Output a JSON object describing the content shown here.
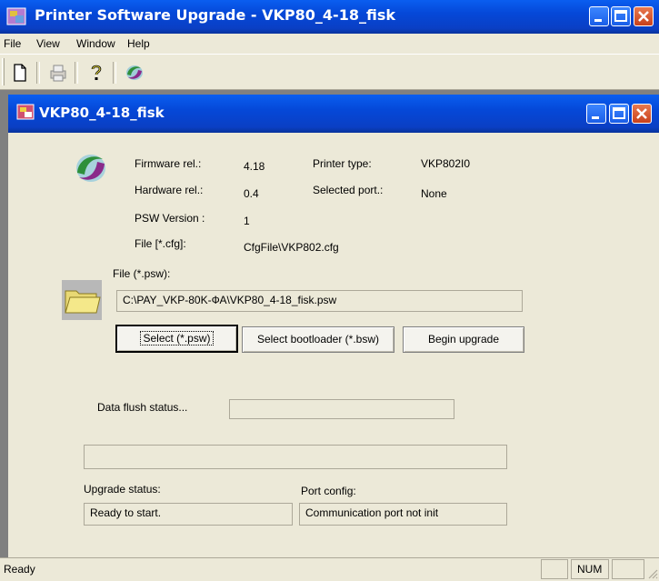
{
  "outer_window": {
    "title": "Printer Software Upgrade - VKP80_4-18_fisk"
  },
  "menu": {
    "items": [
      "File",
      "View",
      "Window",
      "Help"
    ]
  },
  "toolbar": {
    "icons": [
      "new-document-icon",
      "print-icon",
      "help-icon",
      "logo-icon"
    ]
  },
  "child_window": {
    "title": "VKP80_4-18_fisk"
  },
  "info": {
    "firmware_label": "Firmware rel.:",
    "firmware_value": "4.18",
    "hardware_label": "Hardware rel.:",
    "hardware_value": "0.4",
    "psw_version_label": "PSW Version :",
    "psw_version_value": "1",
    "cfg_label": "File [*.cfg]:",
    "cfg_value": "CfgFile\\VKP802.cfg",
    "printer_type_label": "Printer type:",
    "printer_type_value": "VKP802I0",
    "selected_port_label": "Selected port.:",
    "selected_port_value": "None"
  },
  "file": {
    "label": "File (*.psw):",
    "path": "C:\\PAY_VKP-80K-ФА\\VKP80_4-18_fisk.psw"
  },
  "buttons": {
    "select_psw": "Select (*.psw)",
    "select_bootloader": "Select bootloader (*.bsw)",
    "begin_upgrade": "Begin upgrade"
  },
  "flush": {
    "label": "Data flush status...",
    "value": ""
  },
  "progress": {
    "value": 0
  },
  "upgrade_status": {
    "label": "Upgrade status:",
    "value": "Ready to start."
  },
  "port_config": {
    "label": "Port config:",
    "value": "Communication port not init"
  },
  "statusbar": {
    "text": "Ready",
    "num": "NUM"
  },
  "colors": {
    "title_blue": "#0548d8",
    "close_red": "#c9411b",
    "face": "#ece9d8"
  }
}
